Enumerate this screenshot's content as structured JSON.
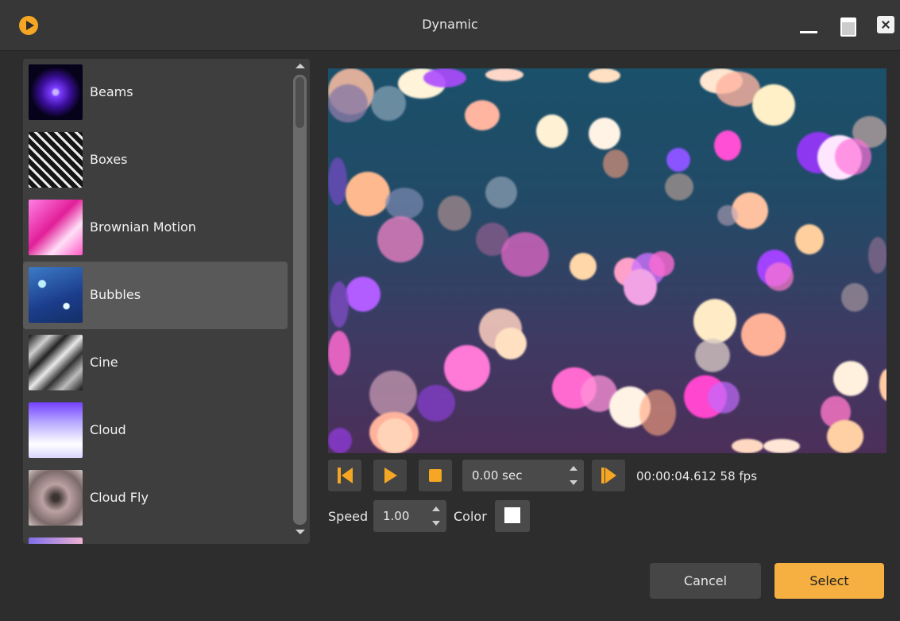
{
  "window": {
    "title": "Dynamic",
    "app_icon": "play-circle-icon"
  },
  "effects_list": {
    "selected": "Bubbles",
    "items": [
      {
        "label": "Beams",
        "thumb": "beams-thumbnail"
      },
      {
        "label": "Boxes",
        "thumb": "boxes-thumbnail"
      },
      {
        "label": "Brownian Motion",
        "thumb": "brownian-motion-thumbnail"
      },
      {
        "label": "Bubbles",
        "thumb": "bubbles-thumbnail"
      },
      {
        "label": "Cine",
        "thumb": "cine-thumbnail"
      },
      {
        "label": "Cloud",
        "thumb": "cloud-thumbnail"
      },
      {
        "label": "Cloud Fly",
        "thumb": "cloud-fly-thumbnail"
      }
    ]
  },
  "preview": {
    "content": "bokeh-bubbles-animation"
  },
  "controls": {
    "time_value": "0.00 sec",
    "timecode": "00:00:04.612 58 fps",
    "speed_label": "Speed",
    "speed_value": "1.00",
    "color_label": "Color",
    "color_value": "#ffffff"
  },
  "buttons": {
    "cancel": "Cancel",
    "select": "Select"
  },
  "colors": {
    "accent": "#f5a623",
    "background": "#2d2d2d",
    "selected_row": "#595959"
  }
}
